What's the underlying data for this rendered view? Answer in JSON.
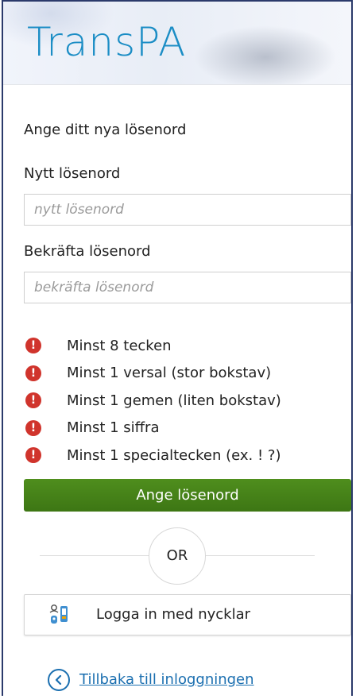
{
  "brand": {
    "logo_text": "TransPA"
  },
  "form": {
    "subtitle": "Ange ditt nya lösenord",
    "new_password_label": "Nytt lösenord",
    "new_password_placeholder": "nytt lösenord",
    "confirm_password_label": "Bekräfta lösenord",
    "confirm_password_placeholder": "bekräfta lösenord"
  },
  "rules": [
    {
      "text": "Minst 8 tecken",
      "icon": "error-exclamation-icon"
    },
    {
      "text": "Minst 1 versal (stor bokstav)",
      "icon": "error-exclamation-icon"
    },
    {
      "text": "Minst 1 gemen (liten bokstav)",
      "icon": "error-exclamation-icon"
    },
    {
      "text": "Minst 1 siffra",
      "icon": "error-exclamation-icon"
    },
    {
      "text": "Minst 1 specialtecken (ex. ! ?)",
      "icon": "error-exclamation-icon"
    }
  ],
  "actions": {
    "submit_label": "Ange lösenord",
    "or_label": "OR",
    "key_login_label": "Logga in med nycklar",
    "back_label": "Tillbaka till inloggningen"
  },
  "colors": {
    "brand_blue": "#1b8dc5",
    "error_red": "#d0342c",
    "primary_green": "#4f8e1d",
    "link_blue": "#1b6fb0"
  }
}
